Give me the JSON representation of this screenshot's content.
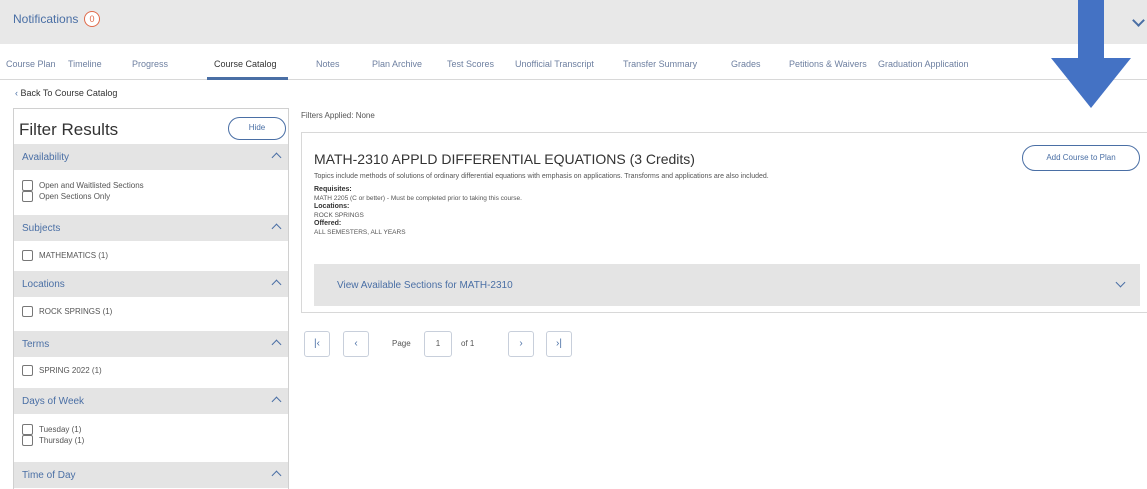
{
  "notifications": {
    "label": "Notifications",
    "count": "0"
  },
  "tabs": [
    "Course Plan",
    "Timeline",
    "Progress",
    "Course Catalog",
    "Notes",
    "Plan Archive",
    "Test Scores",
    "Unofficial Transcript",
    "Transfer Summary",
    "Grades",
    "Petitions & Waivers",
    "Graduation Application"
  ],
  "active_tab": "Course Catalog",
  "back_link": "Back To Course Catalog",
  "filter": {
    "title": "Filter Results",
    "hide_label": "Hide",
    "sections": [
      {
        "label": "Availability",
        "options": [
          "Open and Waitlisted Sections",
          "Open Sections Only"
        ]
      },
      {
        "label": "Subjects",
        "options": [
          "MATHEMATICS (1)"
        ]
      },
      {
        "label": "Locations",
        "options": [
          "ROCK SPRINGS (1)"
        ]
      },
      {
        "label": "Terms",
        "options": [
          "SPRING 2022 (1)"
        ]
      },
      {
        "label": "Days of Week",
        "options": [
          "Tuesday (1)",
          "Thursday (1)"
        ]
      },
      {
        "label": "Time of Day",
        "options": []
      }
    ]
  },
  "main": {
    "filters_applied": "Filters Applied: None",
    "course": {
      "title": "MATH-2310 APPLD DIFFERENTIAL EQUATIONS (3 Credits)",
      "add_button": "Add Course to Plan",
      "description": "Topics include methods of solutions of ordinary differential equations with emphasis on applications. Transforms and applications are also included.",
      "requisites_label": "Requisites:",
      "requisites": "MATH 2205 (C or better) - Must be completed prior to taking this course.",
      "locations_label": "Locations:",
      "locations": "ROCK SPRINGS",
      "offered_label": "Offered:",
      "offered": "ALL SEMESTERS, ALL YEARS",
      "sections_label": "View Available Sections for MATH-2310"
    },
    "pagination": {
      "page_label": "Page",
      "page": "1",
      "of_label": "of 1"
    }
  },
  "colors": {
    "accent": "#4a6fa5",
    "arrow": "#4472c4",
    "section_bg": "#e4e4e4"
  },
  "icons": {
    "first": "first-page-icon",
    "prev": "prev-page-icon",
    "next": "next-page-icon",
    "last": "last-page-icon",
    "arrow": "down-arrow-annotation"
  }
}
